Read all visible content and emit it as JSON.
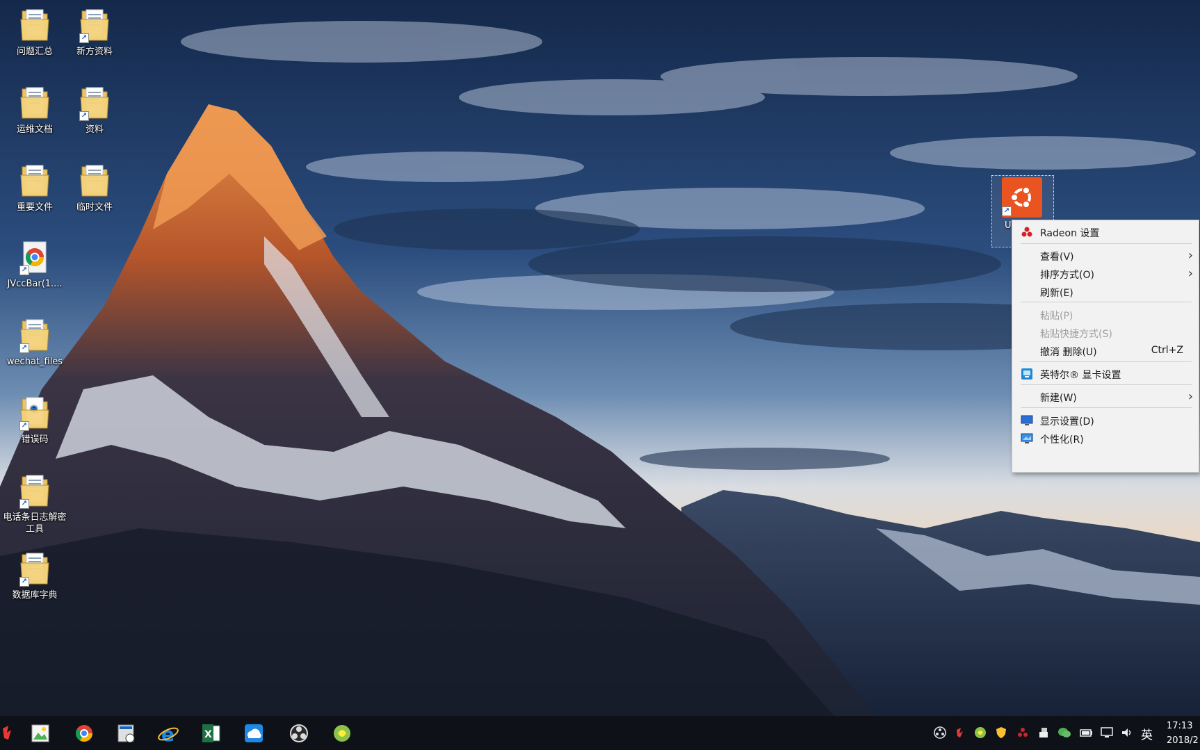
{
  "desktop": {
    "icons": [
      {
        "label": "问题汇总",
        "icon": "folder-icon",
        "shortcut": false
      },
      {
        "label": "新方资料",
        "icon": "folder-icon",
        "shortcut": true
      },
      {
        "label": "运维文档",
        "icon": "folder-icon",
        "shortcut": false
      },
      {
        "label": "资料",
        "icon": "folder-icon",
        "shortcut": true
      },
      {
        "label": "重要文件",
        "icon": "folder-icon",
        "shortcut": false
      },
      {
        "label": "临时文件",
        "icon": "folder-icon",
        "shortcut": false
      },
      {
        "label": "JVccBar(1....",
        "icon": "chrome-shortcut-icon",
        "shortcut": true
      },
      {
        "label": "wechat_files",
        "icon": "folder-icon",
        "shortcut": true
      },
      {
        "label": "错误码",
        "icon": "document-icon",
        "shortcut": true
      },
      {
        "label": "电话条日志解密工具",
        "icon": "folder-icon",
        "shortcut": true
      },
      {
        "label": "数据库字典",
        "icon": "folder-icon",
        "shortcut": true
      }
    ],
    "selected_icon": {
      "label": "U",
      "icon": "ubuntu-icon",
      "accent": "#e95420"
    }
  },
  "context_menu": {
    "items": [
      {
        "label": "Radeon 设置",
        "icon": "radeon-icon",
        "shortcut": "",
        "submenu": false,
        "enabled": true
      },
      {
        "label": "查看(V)",
        "icon": "",
        "shortcut": "",
        "submenu": true,
        "enabled": true
      },
      {
        "label": "排序方式(O)",
        "icon": "",
        "shortcut": "",
        "submenu": true,
        "enabled": true
      },
      {
        "label": "刷新(E)",
        "icon": "",
        "shortcut": "",
        "submenu": false,
        "enabled": true
      },
      {
        "label": "粘贴(P)",
        "icon": "",
        "shortcut": "",
        "submenu": false,
        "enabled": false
      },
      {
        "label": "粘贴快捷方式(S)",
        "icon": "",
        "shortcut": "",
        "submenu": false,
        "enabled": false
      },
      {
        "label": "撤消 删除(U)",
        "icon": "",
        "shortcut": "Ctrl+Z",
        "submenu": false,
        "enabled": true
      },
      {
        "label": "英特尔® 显卡设置",
        "icon": "intel-graphics-icon",
        "shortcut": "",
        "submenu": false,
        "enabled": true
      },
      {
        "label": "新建(W)",
        "icon": "",
        "shortcut": "",
        "submenu": true,
        "enabled": true
      },
      {
        "label": "显示设置(D)",
        "icon": "display-icon",
        "shortcut": "",
        "submenu": false,
        "enabled": true
      },
      {
        "label": "个性化(R)",
        "icon": "personalize-icon",
        "shortcut": "",
        "submenu": false,
        "enabled": true
      }
    ]
  },
  "taskbar": {
    "apps": [
      "app-icon",
      "image-editor-icon",
      "chrome-icon",
      "file-manager-icon",
      "ie-icon",
      "excel-icon",
      "cloud-drive-icon",
      "obs-icon",
      "kiwi-icon"
    ],
    "tray": [
      "obs-tray-icon",
      "app-tray-icon",
      "kiwi-tray-icon",
      "shield-icon",
      "radeon-tray-icon",
      "wechat-icon",
      "usb-icon",
      "battery-icon",
      "network-icon",
      "volume-icon"
    ],
    "ime": "英",
    "time": "17:13",
    "date": "2018/2"
  }
}
